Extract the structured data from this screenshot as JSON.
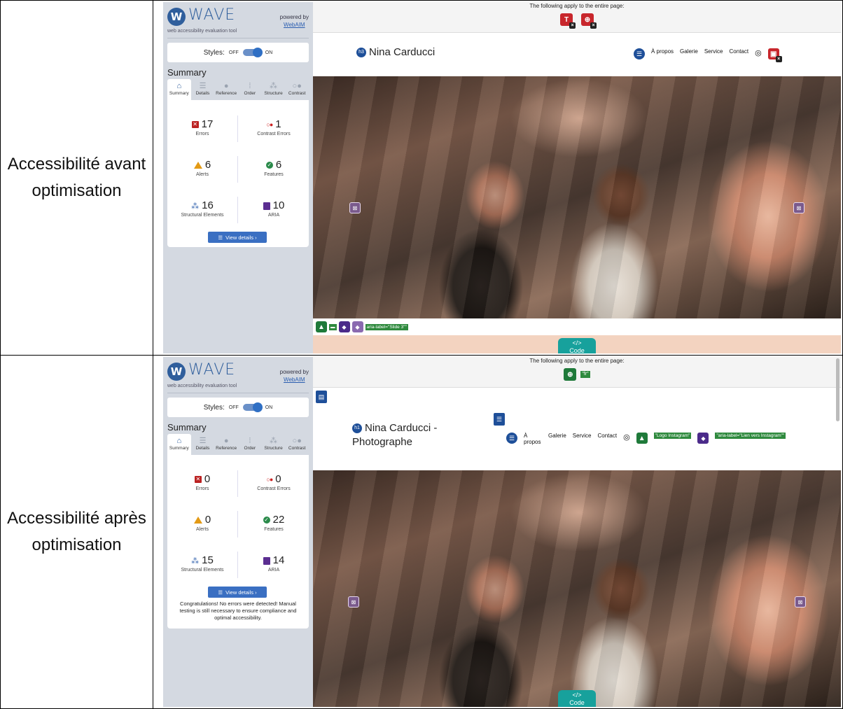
{
  "rows": [
    {
      "label": "Accessibilité avant optimisation",
      "wave": {
        "title": "WAVE",
        "subtitle": "web accessibility evaluation tool",
        "powered_by": "powered by",
        "powered_link": "WebAIM",
        "styles_label": "Styles:",
        "toggle_off": "OFF",
        "toggle_on": "ON",
        "summary_title": "Summary",
        "tabs": [
          "Summary",
          "Details",
          "Reference",
          "Order",
          "Structure",
          "Contrast"
        ],
        "stats": {
          "errors": {
            "value": "17",
            "label": "Errors"
          },
          "contrast": {
            "value": "1",
            "label": "Contrast Errors"
          },
          "alerts": {
            "value": "6",
            "label": "Alerts"
          },
          "features": {
            "value": "6",
            "label": "Features"
          },
          "structural": {
            "value": "16",
            "label": "Structural Elements"
          },
          "aria": {
            "value": "10",
            "label": "ARIA"
          }
        },
        "view_details": "View details ›"
      },
      "page": {
        "applies": "The following apply to the entire page:",
        "heading_badge": "h3",
        "site_title": "Nina Carducci",
        "nav": [
          "À propos",
          "Galerie",
          "Service",
          "Contact"
        ],
        "code_label": "Code",
        "bottom_tags": [
          "",
          "aria-label=\"Slide 3\"\""
        ]
      }
    },
    {
      "label": "Accessibilité après optimisation",
      "wave": {
        "title": "WAVE",
        "subtitle": "web accessibility evaluation tool",
        "powered_by": "powered by",
        "powered_link": "WebAIM",
        "styles_label": "Styles:",
        "toggle_off": "OFF",
        "toggle_on": "ON",
        "summary_title": "Summary",
        "tabs": [
          "Summary",
          "Details",
          "Reference",
          "Order",
          "Structure",
          "Contrast"
        ],
        "stats": {
          "errors": {
            "value": "0",
            "label": "Errors"
          },
          "contrast": {
            "value": "0",
            "label": "Contrast Errors"
          },
          "alerts": {
            "value": "0",
            "label": "Alerts"
          },
          "features": {
            "value": "22",
            "label": "Features"
          },
          "structural": {
            "value": "15",
            "label": "Structural Elements"
          },
          "aria": {
            "value": "14",
            "label": "ARIA"
          }
        },
        "view_details": "View details ›",
        "congrats": "Congratulations! No errors were detected! Manual testing is still necessary to ensure compliance and optimal accessibility."
      },
      "page": {
        "applies": "The following apply to the entire page:",
        "lang_chip": "\"fr\"",
        "heading_badge": "h1",
        "site_title_1": "Nina Carducci -",
        "site_title_2": "Photographe",
        "nav": [
          "À propos",
          "Galerie",
          "Service",
          "Contact"
        ],
        "logo_tag": "\"Logo Instagram\"",
        "aria_tag": "\"aria-label=\"Lien vers Instagram\"\"",
        "code_label": "Code"
      }
    }
  ],
  "colors": {
    "wave_bg": "#d4d9e1",
    "wave_blue": "#2f5e9c",
    "error_red": "#c8262c",
    "feature_green": "#1f7a3a",
    "aria_purple": "#5b2e91",
    "code_teal": "#17a19c"
  },
  "icons": [
    "home-icon",
    "list-icon",
    "info-icon",
    "order-icon",
    "structure-icon",
    "contrast-icon",
    "error-icon",
    "alert-icon",
    "feature-icon",
    "aria-icon",
    "language-icon",
    "instagram-icon"
  ]
}
